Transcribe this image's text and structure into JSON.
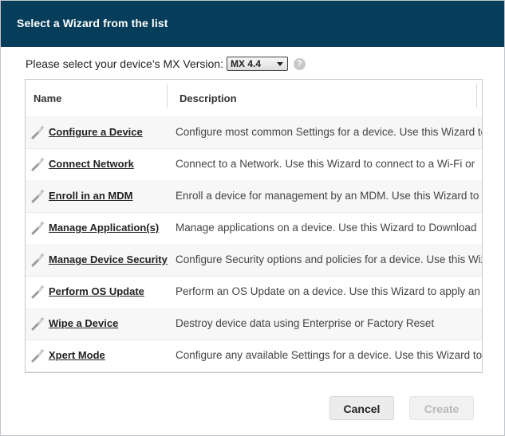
{
  "dialog": {
    "title": "Select a Wizard from the list",
    "version_label": "Please select your device’s MX Version:",
    "version_value": "MX 4.4",
    "help_glyph": "?"
  },
  "table": {
    "columns": {
      "name": "Name",
      "description": "Description"
    },
    "rows": [
      {
        "name": "Configure a Device",
        "description": "Configure most common Settings for a device. Use this Wizard to"
      },
      {
        "name": "Connect Network",
        "description": "Connect to a Network. Use this Wizard to connect to a Wi-Fi or"
      },
      {
        "name": "Enroll in an MDM",
        "description": "Enroll a device for management by an MDM.  Use this Wizard to"
      },
      {
        "name": "Manage Application(s)",
        "description": "Manage applications on a device.  Use this Wizard to Download"
      },
      {
        "name": "Manage Device Security",
        "description": "Configure Security options and policies for a device.  Use this Wizard"
      },
      {
        "name": "Perform OS Update",
        "description": "Perform an OS Update on a device.  Use this Wizard to apply an"
      },
      {
        "name": "Wipe a Device",
        "description": "Destroy device data using Enterprise or Factory Reset"
      },
      {
        "name": "Xpert Mode",
        "description": "Configure any available Settings for a device. Use this Wizard to"
      }
    ]
  },
  "buttons": {
    "cancel": "Cancel",
    "create": "Create"
  },
  "colors": {
    "titlebar": "#063d5a",
    "row_alt": "#f7f7f7"
  },
  "icons": {
    "row_icon": "magic-wand-icon",
    "help_icon": "help-icon"
  }
}
